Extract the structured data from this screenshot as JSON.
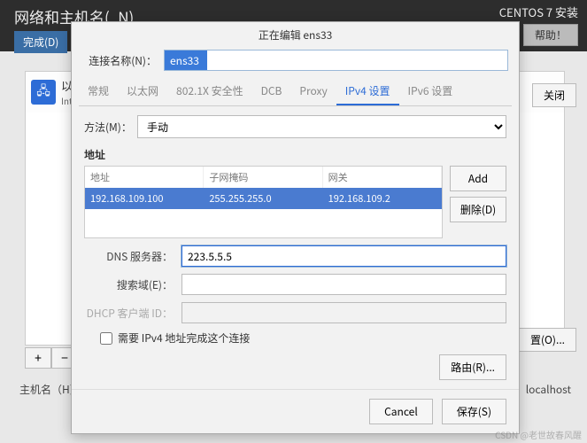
{
  "installer": {
    "title": "网络和主机名(_N)",
    "product": "CENTOS 7 安装",
    "done": "完成(D)",
    "help": "帮助！",
    "eth_name": "以太",
    "eth_sub": "Intel",
    "close": "关闭",
    "configure": "置(O)...",
    "hostname_label": "主机名（H）",
    "hostname_value": "localhost",
    "add": "+",
    "remove": "−"
  },
  "dialog": {
    "title": "正在编辑 ens33",
    "conn_label": "连接名称(N)：",
    "conn_value": "ens33",
    "tabs": {
      "general": "常规",
      "ethernet": "以太网",
      "security": "802.1X 安全性",
      "dcb": "DCB",
      "proxy": "Proxy",
      "ipv4": "IPv4 设置",
      "ipv6": "IPv6 设置"
    },
    "method_label": "方法(M)：",
    "method_value": "手动",
    "address_section": "地址",
    "addr_headers": {
      "addr": "地址",
      "mask": "子网掩码",
      "gw": "网关"
    },
    "addr_row": {
      "addr": "192.168.109.100",
      "mask": "255.255.255.0",
      "gw": "192.168.109.2"
    },
    "add_btn": "Add",
    "del_btn": "删除(D)",
    "dns_label": "DNS 服务器：",
    "dns_value": "223.5.5.5",
    "search_label": "搜索域(E)：",
    "search_value": "",
    "dhcp_label": "DHCP 客户端 ID：",
    "dhcp_value": "",
    "require_ipv4": "需要 IPv4 地址完成这个连接",
    "routes_btn": "路由(R)...",
    "cancel": "Cancel",
    "save": "保存(S)"
  },
  "watermark": "CSDN @老世故春风醒"
}
